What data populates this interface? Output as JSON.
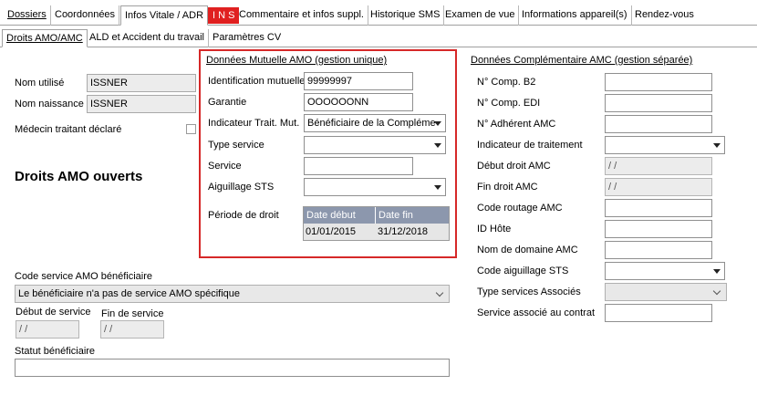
{
  "tabs": {
    "dossiers": "Dossiers",
    "coordonnees": "Coordonnées",
    "infos_vitale": "Infos Vitale / ADR",
    "ins": "I N S",
    "commentaire": "Commentaire et infos suppl.",
    "historique_sms": "Historique SMS",
    "examen_vue": "Examen de vue",
    "infos_appareil": "Informations appareil(s)",
    "rendez_vous": "Rendez-vous"
  },
  "subtabs": {
    "droits_amo": "Droits AMO/AMC",
    "ald": "ALD et Accident du travail",
    "parametres_cv": "Paramètres CV"
  },
  "left": {
    "nom_utilise_label": "Nom utilisé",
    "nom_utilise_value": "ISSNER",
    "nom_naissance_label": "Nom naissance",
    "nom_naissance_value": "ISSNER",
    "medecin_label": "Médecin traitant déclaré",
    "droits_title": "Droits AMO ouverts",
    "code_service_label": "Code service AMO bénéficiaire",
    "code_service_value": "Le bénéficiaire n'a pas de service AMO spécifique",
    "debut_service_label": "Début de service",
    "debut_service_value": "/ /",
    "fin_service_label": "Fin de service",
    "fin_service_value": "/ /",
    "statut_label": "Statut bénéficiaire",
    "statut_value": ""
  },
  "mutuelle": {
    "title": "Données Mutuelle AMO (gestion unique)",
    "identification_label": "Identification mutuelle",
    "identification_value": "99999997",
    "garantie_label": "Garantie",
    "garantie_value": "OOOOOONN",
    "indicateur_label": "Indicateur Trait. Mut.",
    "indicateur_value": "Bénéficiaire de la Compléme",
    "type_service_label": "Type service",
    "type_service_value": "",
    "service_label": "Service",
    "service_value": "",
    "aiguillage_label": "Aiguillage STS",
    "aiguillage_value": "",
    "periode_label": "Période de droit",
    "periode_headers": [
      "Date début",
      "Date fin"
    ],
    "periode_row": [
      "01/01/2015",
      "31/12/2018"
    ]
  },
  "amc": {
    "title": "Données Complémentaire AMC (gestion séparée)",
    "comp_b2_label": "N° Comp. B2",
    "comp_edi_label": "N° Comp. EDI",
    "adherent_label": "N° Adhérent AMC",
    "indicateur_label": "Indicateur de traitement",
    "debut_label": "Début droit AMC",
    "debut_value": "/ /",
    "fin_label": "Fin droit AMC",
    "fin_value": "/ /",
    "code_routage_label": "Code routage AMC",
    "id_hote_label": "ID Hôte",
    "nom_domaine_label": "Nom de domaine AMC",
    "code_aiguillage_label": "Code aiguillage STS",
    "type_services_label": "Type services Associés",
    "service_associe_label": "Service associé au contrat"
  }
}
